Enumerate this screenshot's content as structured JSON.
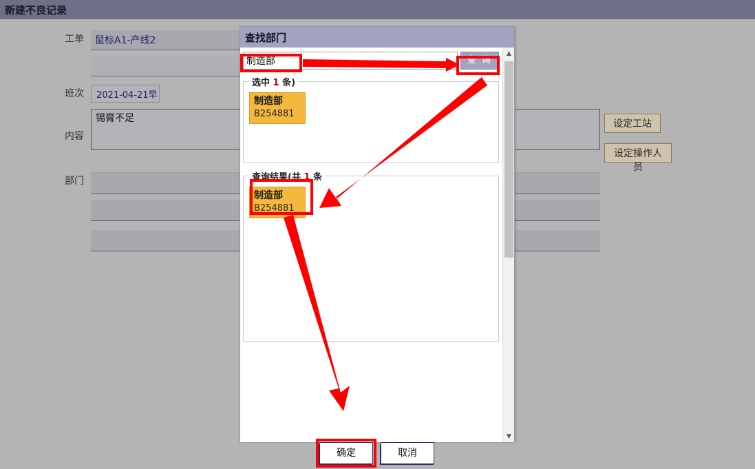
{
  "main_window": {
    "title": "新建不良记录",
    "fields": {
      "workorder_label": "工单",
      "workorder_value": "鼠标A1-产线2",
      "shift_label": "班次",
      "shift_value": "2021-04-21早",
      "content_label": "内容",
      "content_value": "锡膏不足",
      "department_label": "部门",
      "department_value": "",
      "station_value": "",
      "operator_value": ""
    },
    "side_buttons": {
      "set_station": "设定工站",
      "set_operator": "设定操作人员"
    },
    "footer_buttons": {
      "ok": "确定",
      "cancel": "取消"
    }
  },
  "dialog": {
    "title": "查找部门",
    "search": {
      "value": "制造部",
      "placeholder": "",
      "button_label": "查 询"
    },
    "selected_panel": {
      "legend_prefix": "选中",
      "legend_count": "1",
      "legend_suffix": "条)",
      "items": [
        {
          "name": "制造部",
          "code": "B254881"
        }
      ]
    },
    "results_panel": {
      "legend_prefix": "查询结果(共",
      "legend_count": "1",
      "legend_suffix": "条",
      "items": [
        {
          "name": "制造部",
          "code": "B254881"
        }
      ]
    },
    "footer_buttons": {
      "ok": "确定",
      "cancel": "取消"
    },
    "scrollbar": {
      "up_icon": "triangle-up-icon",
      "down_icon": "triangle-down-icon"
    }
  },
  "annotations": {
    "color": "#ff0000",
    "arrows": [
      {
        "name": "search-input-to-query-button"
      },
      {
        "name": "query-button-to-selected-result"
      },
      {
        "name": "selected-result-to-confirm-button"
      }
    ],
    "boxes": [
      {
        "name": "search-input-highlight"
      },
      {
        "name": "query-button-highlight"
      },
      {
        "name": "result-item-highlight"
      },
      {
        "name": "dialog-confirm-button-highlight"
      }
    ]
  },
  "icons": {
    "chevron_down": "▼",
    "triangle_up": "▲",
    "triangle_down": "▼"
  }
}
